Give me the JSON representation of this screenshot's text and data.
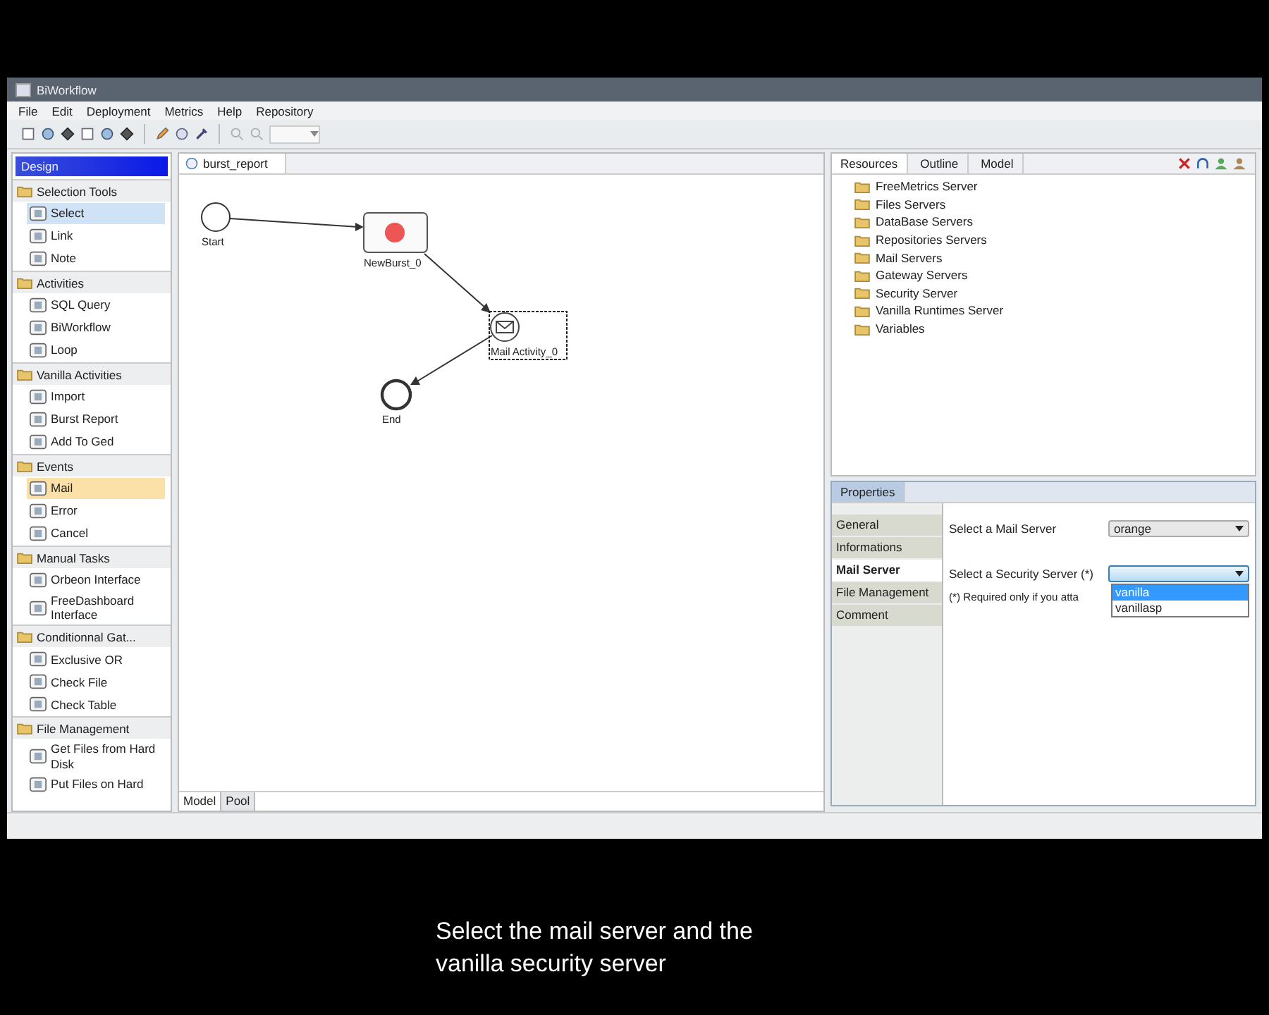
{
  "window": {
    "title": "BiWorkflow"
  },
  "menu": [
    "File",
    "Edit",
    "Deployment",
    "Metrics",
    "Help",
    "Repository"
  ],
  "palette": {
    "title": "Design",
    "sections": [
      {
        "label": "Selection Tools",
        "items": [
          {
            "label": "Select",
            "selected": true
          },
          {
            "label": "Link",
            "selected": false
          },
          {
            "label": "Note",
            "selected": false
          }
        ]
      },
      {
        "label": "Activities",
        "items": [
          {
            "label": "SQL Query",
            "selected": false
          },
          {
            "label": "BiWorkflow",
            "selected": false
          },
          {
            "label": "Loop",
            "selected": false
          }
        ]
      },
      {
        "label": "Vanilla Activities",
        "items": [
          {
            "label": "Import",
            "selected": false
          },
          {
            "label": "Burst Report",
            "selected": false
          },
          {
            "label": "Add To Ged",
            "selected": false
          }
        ]
      },
      {
        "label": "Events",
        "items": [
          {
            "label": "Mail",
            "selected": true
          },
          {
            "label": "Error",
            "selected": false
          },
          {
            "label": "Cancel",
            "selected": false
          }
        ]
      },
      {
        "label": "Manual Tasks",
        "items": [
          {
            "label": "Orbeon Interface",
            "selected": false
          },
          {
            "label": "FreeDashboard Interface",
            "selected": false
          }
        ]
      },
      {
        "label": "Conditionnal Gat...",
        "items": [
          {
            "label": "Exclusive OR",
            "selected": false
          },
          {
            "label": "Check File",
            "selected": false
          },
          {
            "label": "Check Table",
            "selected": false
          }
        ]
      },
      {
        "label": "File Management",
        "items": [
          {
            "label": "Get Files from Hard Disk",
            "selected": false
          },
          {
            "label": "Put Files on Hard",
            "selected": false
          }
        ]
      }
    ]
  },
  "editor": {
    "tab": "burst_report",
    "nodes": [
      {
        "kind": "start",
        "label": "Start",
        "selected": false
      },
      {
        "kind": "activity",
        "label": "NewBurst_0",
        "selected": false
      },
      {
        "kind": "mail",
        "label": "Mail Activity_0",
        "selected": true
      },
      {
        "kind": "end",
        "label": "End",
        "selected": false
      }
    ],
    "bottom_tabs": [
      {
        "label": "Model",
        "selected": true
      },
      {
        "label": "Pool",
        "selected": false
      }
    ]
  },
  "resources": {
    "tabs": [
      {
        "label": "Resources",
        "selected": true
      },
      {
        "label": "Outline",
        "selected": false
      },
      {
        "label": "Model",
        "selected": false
      }
    ],
    "tree": [
      "FreeMetrics Server",
      "Files Servers",
      "DataBase Servers",
      "Repositories Servers",
      "Mail Servers",
      "Gateway Servers",
      "Security Server",
      "Vanilla Runtimes Server",
      "Variables"
    ]
  },
  "properties": {
    "tab": "Properties",
    "sections": [
      {
        "label": "General",
        "selected": false
      },
      {
        "label": "Informations",
        "selected": false
      },
      {
        "label": "Mail Server",
        "selected": true
      },
      {
        "label": "File Management",
        "selected": false
      },
      {
        "label": "Comment",
        "selected": false
      }
    ],
    "mail_server": {
      "label": "Select a Mail Server",
      "value": "orange"
    },
    "security_server": {
      "label": "Select a Security Server (*)",
      "expanded": true,
      "options": [
        {
          "label": "vanilla",
          "selected": true
        },
        {
          "label": "vanillasp",
          "selected": false
        }
      ]
    },
    "note": "(*) Required only if you atta"
  },
  "caption": [
    "Select the mail server and the",
    "vanilla security server"
  ]
}
